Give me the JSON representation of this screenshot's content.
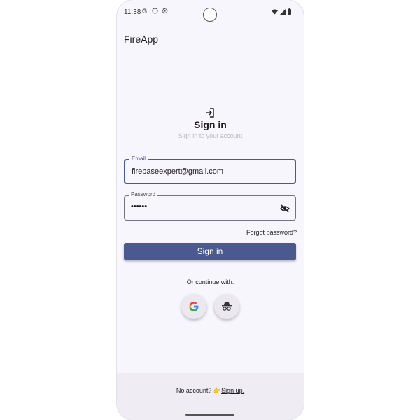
{
  "status_bar": {
    "time": "11:38",
    "left_icons": [
      "google-icon",
      "info-icon",
      "settings-icon"
    ],
    "right_icons": [
      "wifi-icon",
      "signal-icon",
      "battery-icon"
    ]
  },
  "app": {
    "title": "FireApp"
  },
  "signin": {
    "icon": "login-icon",
    "heading": "Sign in",
    "subheading": "Sign in to your account"
  },
  "email": {
    "label": "Email",
    "value": "firebaseexpert@gmail.com"
  },
  "password": {
    "label": "Password",
    "value": "••••••",
    "toggle_icon": "eye-off-icon"
  },
  "forgot_password": "Forgot password?",
  "signin_button": "Sign in",
  "social": {
    "label": "Or continue with:",
    "providers": [
      "google-icon",
      "incognito-icon"
    ]
  },
  "footer": {
    "prompt": "No account? ",
    "emoji": "👉",
    "link": "Sign up."
  },
  "colors": {
    "primary": "#4a5a8e",
    "background": "#f8f6fd",
    "footer_bg": "#efedf3"
  }
}
